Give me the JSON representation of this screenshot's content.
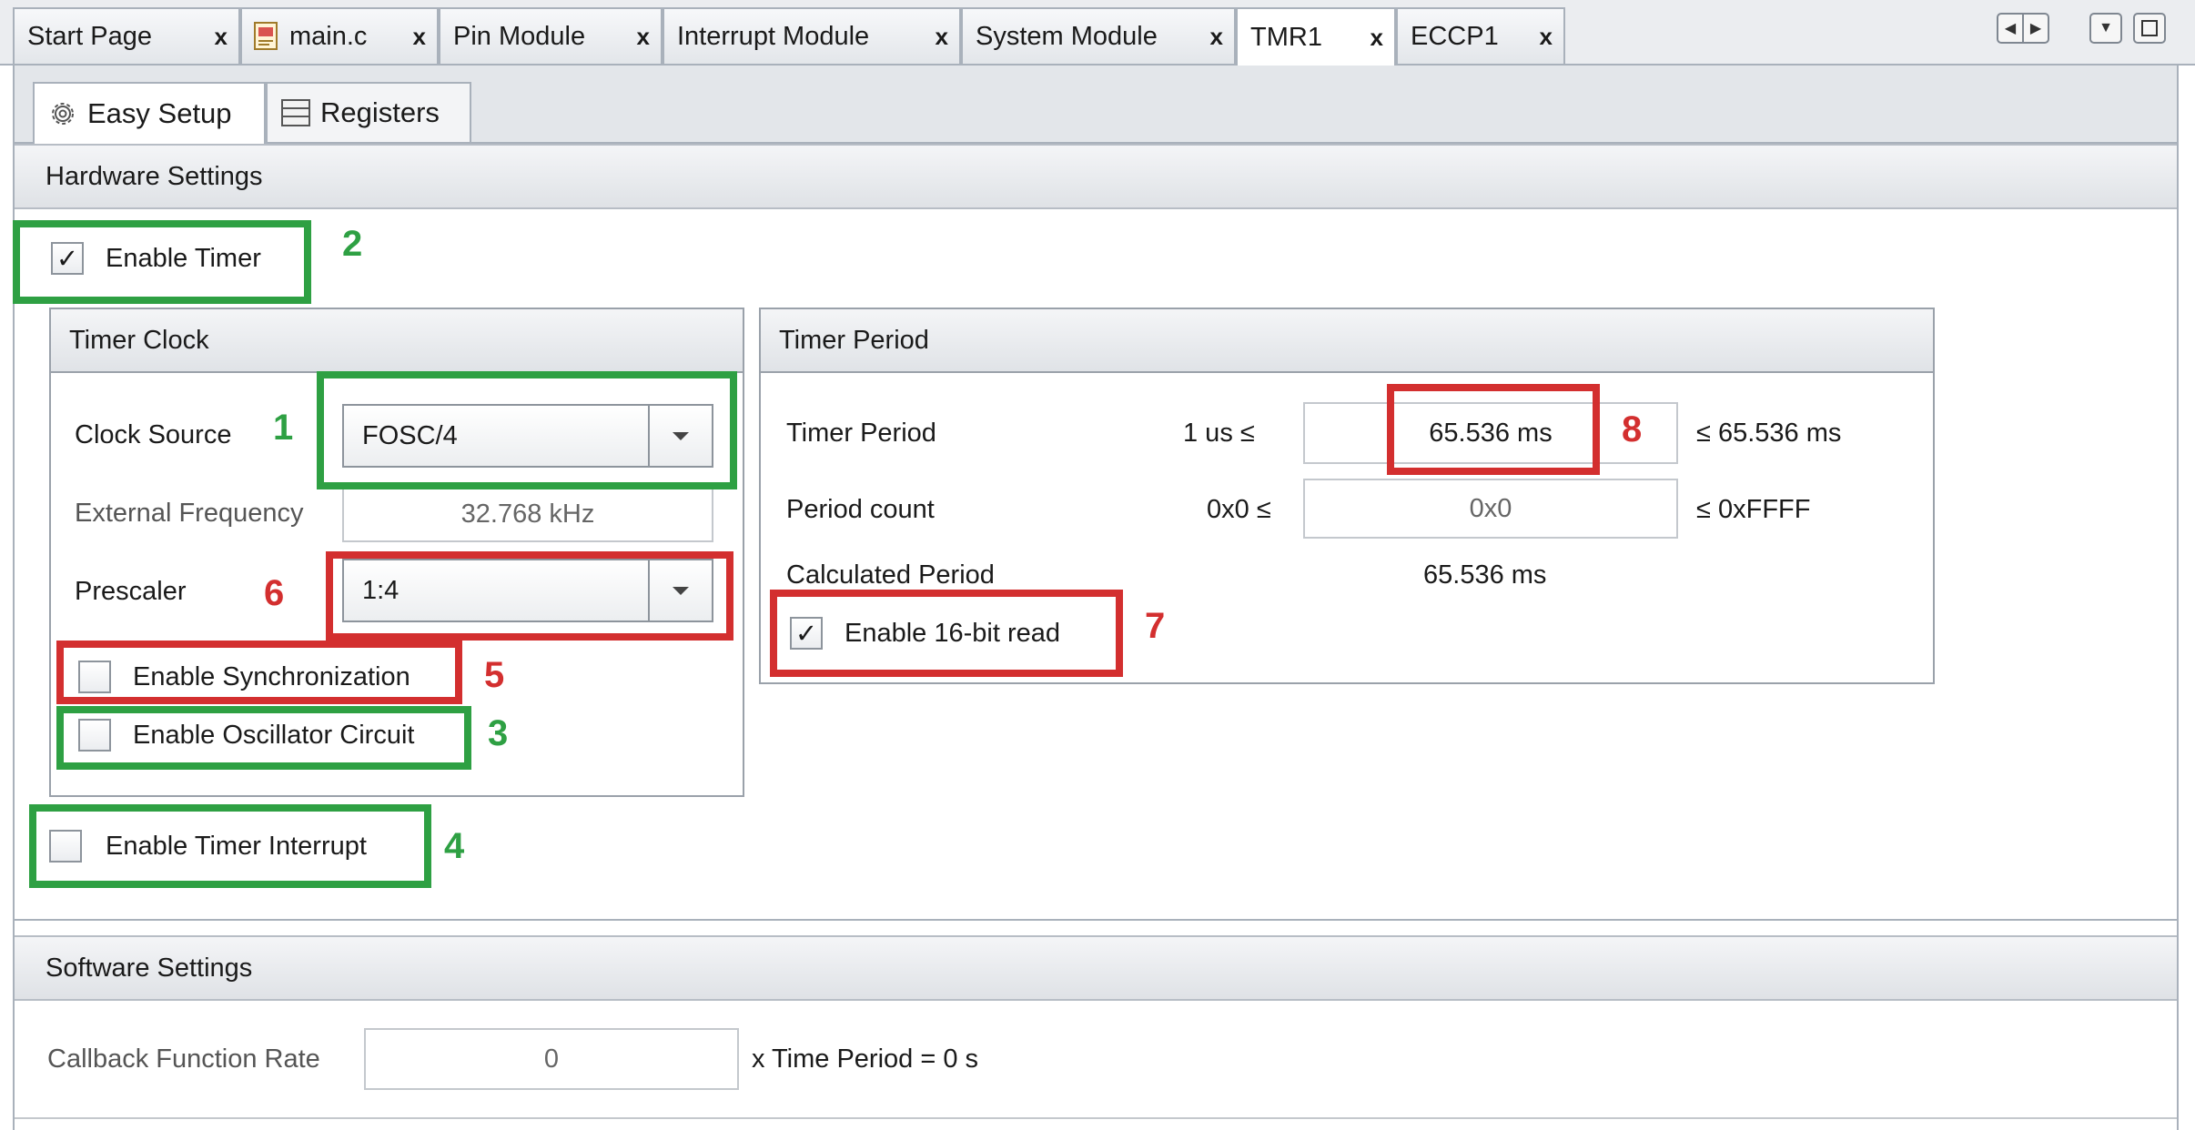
{
  "tabs": [
    {
      "label": "Start Page",
      "close": "x"
    },
    {
      "label": "main.c",
      "close": "x"
    },
    {
      "label": "Pin Module",
      "close": "x"
    },
    {
      "label": "Interrupt Module",
      "close": "x"
    },
    {
      "label": "System Module",
      "close": "x"
    },
    {
      "label": "TMR1",
      "close": "x"
    },
    {
      "label": "ECCP1",
      "close": "x"
    }
  ],
  "subtabs": [
    {
      "label": "Easy Setup",
      "icon": "gear-icon"
    },
    {
      "label": "Registers",
      "icon": "registers-icon"
    }
  ],
  "hardware": {
    "title": "Hardware Settings",
    "enable_timer": {
      "label": "Enable Timer",
      "checked": true
    },
    "timer_clock": {
      "title": "Timer Clock",
      "clock_source_label": "Clock Source",
      "clock_source_value": "FOSC/4",
      "ext_freq_label": "External Frequency",
      "ext_freq_value": "32.768 kHz",
      "prescaler_label": "Prescaler",
      "prescaler_value": "1:4",
      "enable_sync": {
        "label": "Enable Synchronization",
        "checked": false
      },
      "enable_osc": {
        "label": "Enable Oscillator Circuit",
        "checked": false
      }
    },
    "enable_interrupt": {
      "label": "Enable Timer Interrupt",
      "checked": false
    },
    "timer_period": {
      "title": "Timer Period",
      "period_label": "Timer Period",
      "period_min": "1 us ≤",
      "period_value": "65.536 ms",
      "period_max": "≤ 65.536 ms",
      "count_label": "Period count",
      "count_min": "0x0 ≤",
      "count_value": "0x0",
      "count_max": "≤ 0xFFFF",
      "calc_label": "Calculated Period",
      "calc_value": "65.536 ms",
      "enable_16bit": {
        "label": "Enable 16-bit read",
        "checked": true
      }
    }
  },
  "software": {
    "title": "Software Settings",
    "callback_label": "Callback Function Rate",
    "callback_value": "0",
    "callback_suffix": "x Time Period = 0 s"
  },
  "annotations": {
    "n1": "1",
    "n2": "2",
    "n3": "3",
    "n4": "4",
    "n5": "5",
    "n6": "6",
    "n7": "7",
    "n8": "8",
    "green": "#2ea043",
    "red": "#d32f2f"
  }
}
